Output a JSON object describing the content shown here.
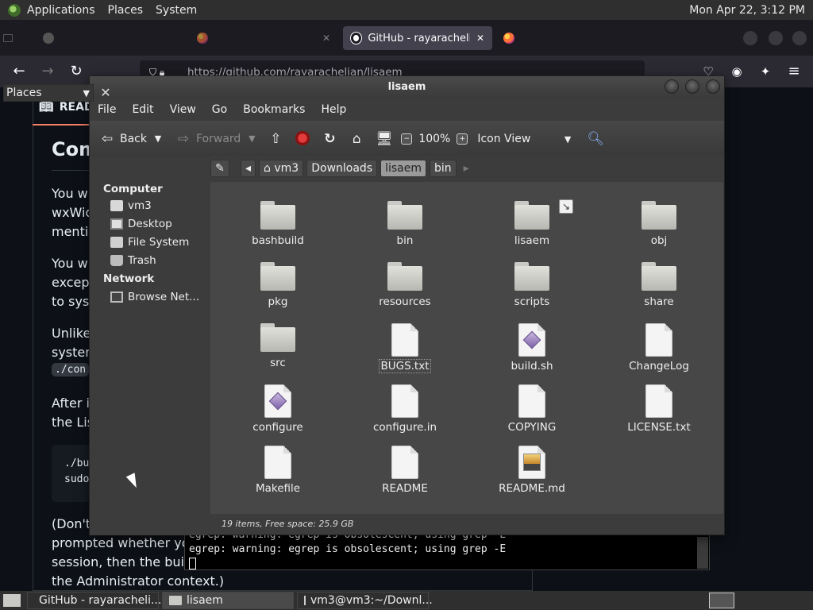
{
  "top_panel": {
    "menus": [
      "Applications",
      "Places",
      "System"
    ],
    "clock": "Mon Apr 22,  3:12 PM"
  },
  "browser": {
    "tabs": [
      {
        "label": "(background tab)",
        "active": false
      },
      {
        "label": "(background tab)",
        "active": false
      },
      {
        "label": "GitHub - rayarachelian",
        "active": true
      },
      {
        "label": "(background tab)",
        "active": false
      }
    ],
    "url": "https://github.com/rayarachelian/lisaem"
  },
  "github_page": {
    "readme_tab": "READ",
    "heading": "Com",
    "para1": [
      "You wi",
      "wxWid",
      "mentic"
    ],
    "para2": [
      "You wi",
      "except",
      "to syst"
    ],
    "para3": [
      "Unlike",
      "system"
    ],
    "inline_code": "./con",
    "para4": [
      "After i",
      "the Lis"
    ],
    "code_lines": [
      "./bu",
      "sudo"
    ],
    "para5": "(Don't",
    "para5_rest": [
      "prompted whether you w",
      "session, then the build v",
      "the Administrator context.)"
    ]
  },
  "terminal": {
    "lines": [
      "egrep: warning: egrep is obsolescent; using grep -E",
      "egrep: warning: egrep is obsolescent; using grep -E"
    ]
  },
  "file_manager": {
    "title": "lisaem",
    "menus": [
      "File",
      "Edit",
      "View",
      "Go",
      "Bookmarks",
      "Help"
    ],
    "toolbar": {
      "back": "Back",
      "forward": "Forward",
      "zoom": "100%",
      "view_mode": "Icon View"
    },
    "places_label": "Places",
    "sidebar": {
      "computer_heading": "Computer",
      "computer_items": [
        {
          "label": "vm3",
          "icon": "home-icon"
        },
        {
          "label": "Desktop",
          "icon": "desktop-icon"
        },
        {
          "label": "File System",
          "icon": "drive-icon"
        },
        {
          "label": "Trash",
          "icon": "trash-icon"
        }
      ],
      "network_heading": "Network",
      "network_items": [
        {
          "label": "Browse Net...",
          "icon": "network-icon"
        }
      ]
    },
    "breadcrumb": [
      "vm3",
      "Downloads",
      "lisaem",
      "bin"
    ],
    "breadcrumb_active": "lisaem",
    "items": [
      {
        "name": "bashbuild",
        "type": "folder"
      },
      {
        "name": "bin",
        "type": "folder"
      },
      {
        "name": "lisaem",
        "type": "folder-link"
      },
      {
        "name": "obj",
        "type": "folder"
      },
      {
        "name": "pkg",
        "type": "folder"
      },
      {
        "name": "resources",
        "type": "folder"
      },
      {
        "name": "scripts",
        "type": "folder"
      },
      {
        "name": "share",
        "type": "folder"
      },
      {
        "name": "src",
        "type": "folder"
      },
      {
        "name": "BUGS.txt",
        "type": "text"
      },
      {
        "name": "build.sh",
        "type": "script"
      },
      {
        "name": "ChangeLog",
        "type": "text"
      },
      {
        "name": "configure",
        "type": "script"
      },
      {
        "name": "configure.in",
        "type": "text"
      },
      {
        "name": "COPYING",
        "type": "text"
      },
      {
        "name": "LICENSE.txt",
        "type": "text"
      },
      {
        "name": "Makefile",
        "type": "text"
      },
      {
        "name": "README",
        "type": "text"
      },
      {
        "name": "README.md",
        "type": "image-doc"
      }
    ],
    "status": "19 items, Free space: 25.9 GB"
  },
  "taskbar": {
    "tasks": [
      {
        "label": "GitHub - rayaracheli...",
        "icon": "firefox-icon",
        "active": false
      },
      {
        "label": "lisaem",
        "icon": "folder-icon",
        "active": true
      },
      {
        "label": "vm3@vm3:~/Downl...",
        "icon": "terminal-icon",
        "active": false
      }
    ]
  }
}
